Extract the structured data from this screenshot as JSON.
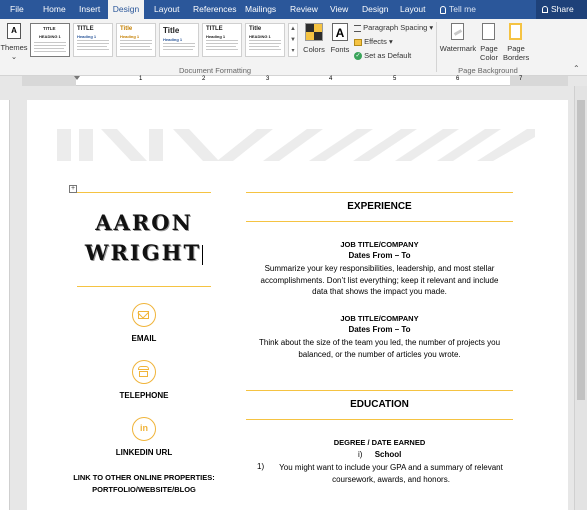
{
  "ribbon_tabs": [
    "File",
    "Home",
    "Insert",
    "Design",
    "Layout",
    "References",
    "Mailings",
    "Review",
    "View",
    "Design",
    "Layout"
  ],
  "active_tab": "Design",
  "tell_me": "Tell me",
  "share": "Share",
  "themes_label": "Themes",
  "styles_gallery": [
    {
      "title": "TITLE",
      "heading": "HEADING 1"
    },
    {
      "title": "TITLE",
      "heading": "Heading 1"
    },
    {
      "title": "Title",
      "heading": "Heading 1"
    },
    {
      "title": "Title",
      "heading": "Heading 1"
    },
    {
      "title": "TITLE",
      "heading": "Heading 1"
    },
    {
      "title": "Title",
      "heading": "HEADING 1"
    }
  ],
  "colors_label": "Colors",
  "fonts_label": "Fonts",
  "paragraph_spacing": "Paragraph Spacing",
  "effects": "Effects",
  "set_as_default": "Set as Default",
  "doc_formatting_group": "Document Formatting",
  "watermark": "Watermark",
  "page_color": "Page Color",
  "page_borders": "Page Borders",
  "page_background_group": "Page Background",
  "ruler_numbers": [
    "1",
    "2",
    "3",
    "4",
    "5",
    "6",
    "7"
  ],
  "resume": {
    "first_name": "AARON",
    "last_name": "WRIGHT",
    "contact": [
      {
        "label": "EMAIL",
        "icon": "email-icon"
      },
      {
        "label": "TELEPHONE",
        "icon": "telephone-icon"
      },
      {
        "label": "LINKEDIN URL",
        "icon": "linkedin-icon"
      }
    ],
    "links_line1": "LINK TO OTHER ONLINE PROPERTIES:",
    "links_line2": "PORTFOLIO/WEBSITE/BLOG",
    "experience_heading": "EXPERIENCE",
    "jobs": [
      {
        "title": "JOB TITLE/COMPANY",
        "dates": "Dates From – To",
        "desc": "Summarize your key responsibilities, leadership, and most stellar accomplishments. Don’t list everything; keep it relevant and include data that shows the impact you made."
      },
      {
        "title": "JOB TITLE/COMPANY",
        "dates": "Dates From – To",
        "desc": "Think about the size of the team you led, the number of projects you balanced, or the number of articles you wrote."
      }
    ],
    "education_heading": "EDUCATION",
    "degree": "DEGREE / DATE EARNED",
    "school_number": "i)",
    "school": "School",
    "edu_number": "1)",
    "edu_desc": "You might want to include your GPA and a summary of relevant coursework, awards, and honors."
  },
  "colors": {
    "ribbon": "#2b579a",
    "accent": "#f5c342"
  }
}
